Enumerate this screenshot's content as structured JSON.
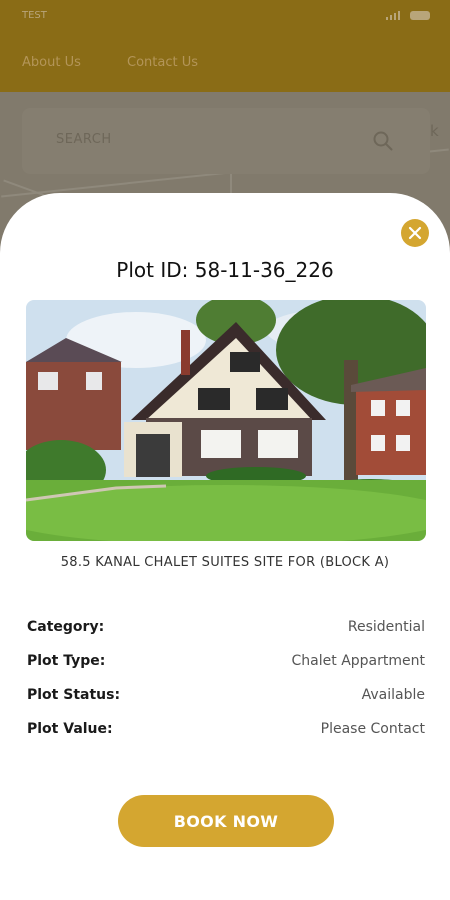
{
  "status_bar": {
    "carrier": "TEST"
  },
  "nav": {
    "about": "About Us",
    "contact": "Contact Us"
  },
  "search": {
    "placeholder": "SEARCH",
    "map_letter": "k"
  },
  "plot": {
    "title": "Plot ID: 58-11-36_226",
    "subtitle": "58.5 KANAL CHALET SUITES SITE FOR (BLOCK A)",
    "details": [
      {
        "label": "Category:",
        "value": "Residential"
      },
      {
        "label": "Plot Type:",
        "value": "Chalet Appartment"
      },
      {
        "label": "Plot Status:",
        "value": "Available"
      },
      {
        "label": "Plot Value:",
        "value": "Please Contact"
      }
    ],
    "book_label": "BOOK NOW"
  },
  "colors": {
    "accent": "#d4a630",
    "header_dim": "#8a6c16"
  },
  "icons": [
    "search-icon",
    "close-icon",
    "signal-icon",
    "battery-icon"
  ]
}
